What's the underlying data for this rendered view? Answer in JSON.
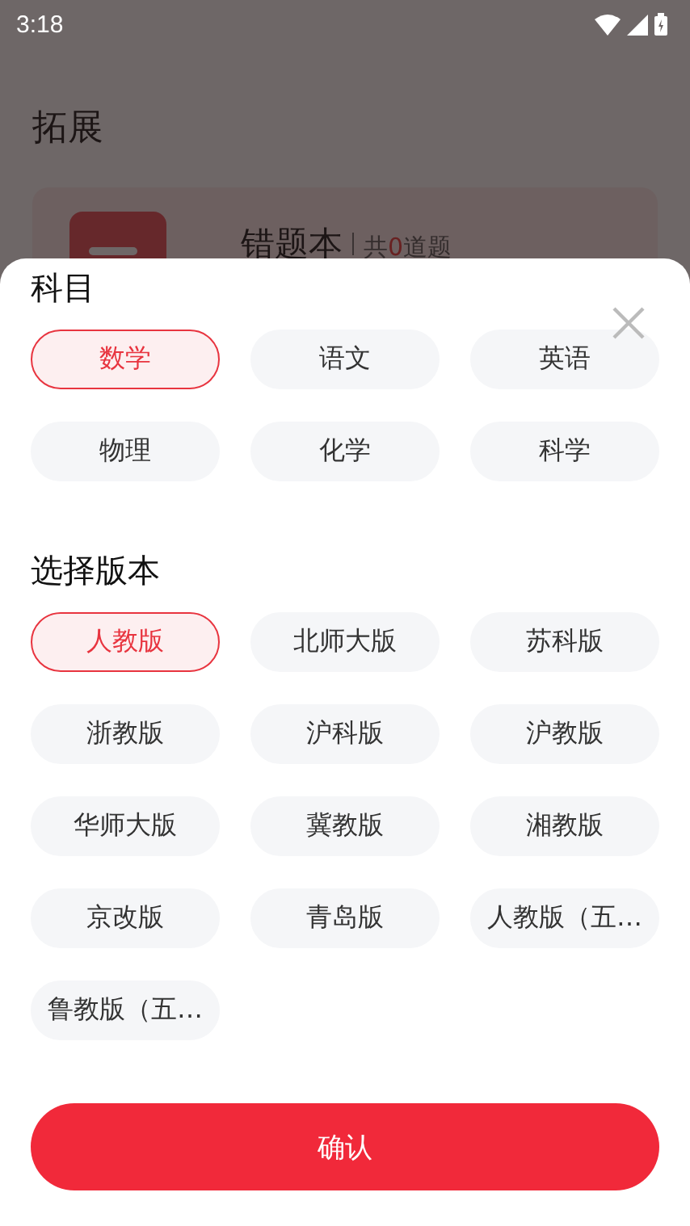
{
  "status_bar": {
    "time": "3:18"
  },
  "background": {
    "title": "拓展",
    "card": {
      "title": "错题本",
      "count_prefix": "共",
      "count": "0",
      "count_suffix": "道题"
    }
  },
  "sheet": {
    "sections": [
      {
        "title": "科目",
        "options": [
          {
            "label": "数学",
            "selected": true
          },
          {
            "label": "语文",
            "selected": false
          },
          {
            "label": "英语",
            "selected": false
          },
          {
            "label": "物理",
            "selected": false
          },
          {
            "label": "化学",
            "selected": false
          },
          {
            "label": "科学",
            "selected": false
          }
        ]
      },
      {
        "title": "选择版本",
        "options": [
          {
            "label": "人教版",
            "selected": true
          },
          {
            "label": "北师大版",
            "selected": false
          },
          {
            "label": "苏科版",
            "selected": false
          },
          {
            "label": "浙教版",
            "selected": false
          },
          {
            "label": "沪科版",
            "selected": false
          },
          {
            "label": "沪教版",
            "selected": false
          },
          {
            "label": "华师大版",
            "selected": false
          },
          {
            "label": "冀教版",
            "selected": false
          },
          {
            "label": "湘教版",
            "selected": false
          },
          {
            "label": "京改版",
            "selected": false
          },
          {
            "label": "青岛版",
            "selected": false
          },
          {
            "label": "人教版（五…",
            "selected": false
          },
          {
            "label": "鲁教版（五…",
            "selected": false
          }
        ]
      }
    ],
    "confirm_button": "确认"
  }
}
